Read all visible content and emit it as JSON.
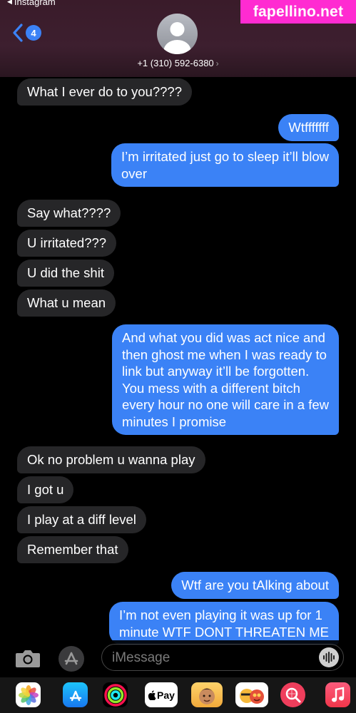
{
  "status_bar": {
    "back_app": "Instagram"
  },
  "header": {
    "unread_badge": "4",
    "contact": "+1 (310) 592-6380",
    "arrow": "›"
  },
  "watermark": "fapellino.net",
  "messages": [
    {
      "dir": "in",
      "text": "What I ever do to you????"
    },
    {
      "dir": "out",
      "text": "Wtfffffff"
    },
    {
      "dir": "out",
      "text": "I’m irritated just go to sleep it’ll blow\nover"
    },
    {
      "dir": "in",
      "text": "Say what????"
    },
    {
      "dir": "in",
      "text": "U irritated???"
    },
    {
      "dir": "in",
      "text": "U did the shit"
    },
    {
      "dir": "in",
      "text": "What u mean"
    },
    {
      "dir": "out",
      "text": "And what you did was act nice and\nthen ghost me when I was ready to\nlink but anyway it’ll be forgotten.\nYou mess with a different bitch\nevery hour no one will care in a few\nminutes I promise"
    },
    {
      "dir": "in",
      "text": "Ok no problem u wanna play"
    },
    {
      "dir": "in",
      "text": "I got u"
    },
    {
      "dir": "in",
      "text": "I play at a diff level"
    },
    {
      "dir": "in",
      "text": "Remember that"
    },
    {
      "dir": "out",
      "text": "Wtf are you tAlking about"
    },
    {
      "dir": "out",
      "text": "I’m not even playing it was up for 1\nminute WTF DONT THREATEN ME"
    }
  ],
  "compose": {
    "placeholder": "iMessage"
  },
  "app_strip": [
    {
      "icon": "photos-icon"
    },
    {
      "icon": "app-store-icon"
    },
    {
      "icon": "activity-icon"
    },
    {
      "icon": "apple-pay-icon",
      "label": "Pay"
    },
    {
      "icon": "memoji-icon"
    },
    {
      "icon": "memoji-stickers-icon"
    },
    {
      "icon": "image-search-icon"
    },
    {
      "icon": "music-icon"
    }
  ],
  "colors": {
    "incoming_bubble": "#262628",
    "outgoing_bubble": "#3b82f6",
    "header_bg": "#3d1f2f",
    "watermark_bg": "#ff2bd1"
  }
}
